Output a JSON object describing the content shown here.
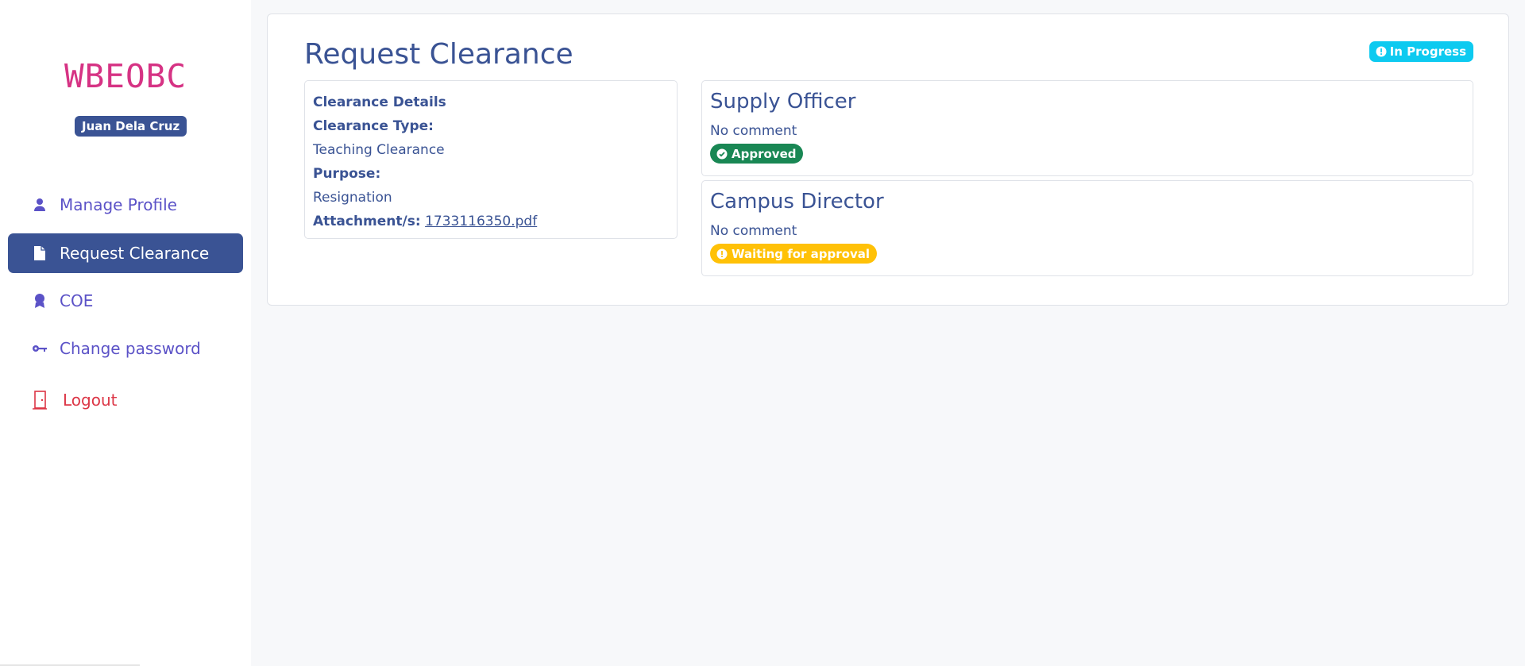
{
  "brand": "WBEOBC",
  "user": {
    "name": "Juan Dela Cruz"
  },
  "nav": {
    "manage_profile": "Manage Profile",
    "request_clearance": "Request Clearance",
    "coe": "COE",
    "change_password": "Change password",
    "logout": "Logout"
  },
  "page": {
    "title": "Request Clearance",
    "status": "In Progress"
  },
  "details": {
    "heading": "Clearance Details",
    "type_label": "Clearance Type:",
    "type_value": "Teaching Clearance",
    "purpose_label": "Purpose:",
    "purpose_value": "Resignation",
    "attachment_label": "Attachment/s:",
    "attachment_file": "1733116350.pdf"
  },
  "approvers": [
    {
      "role": "Supply Officer",
      "comment": "No comment",
      "status": "Approved",
      "status_color": "#198754"
    },
    {
      "role": "Campus Director",
      "comment": "No comment",
      "status": "Waiting for approval",
      "status_color": "#ffc107"
    }
  ],
  "colors": {
    "primary": "#3a5394",
    "brand": "#d63384",
    "nav_link": "#5b52c7",
    "danger": "#dc3545",
    "info": "#0dcaf0"
  },
  "icons": {
    "manage_profile": "user-icon",
    "request_clearance": "file-icon",
    "coe": "award-icon",
    "change_password": "key-icon",
    "logout": "door-icon",
    "in_progress": "exclamation-circle-icon",
    "approved": "check-circle-icon",
    "waiting": "exclamation-circle-icon"
  }
}
